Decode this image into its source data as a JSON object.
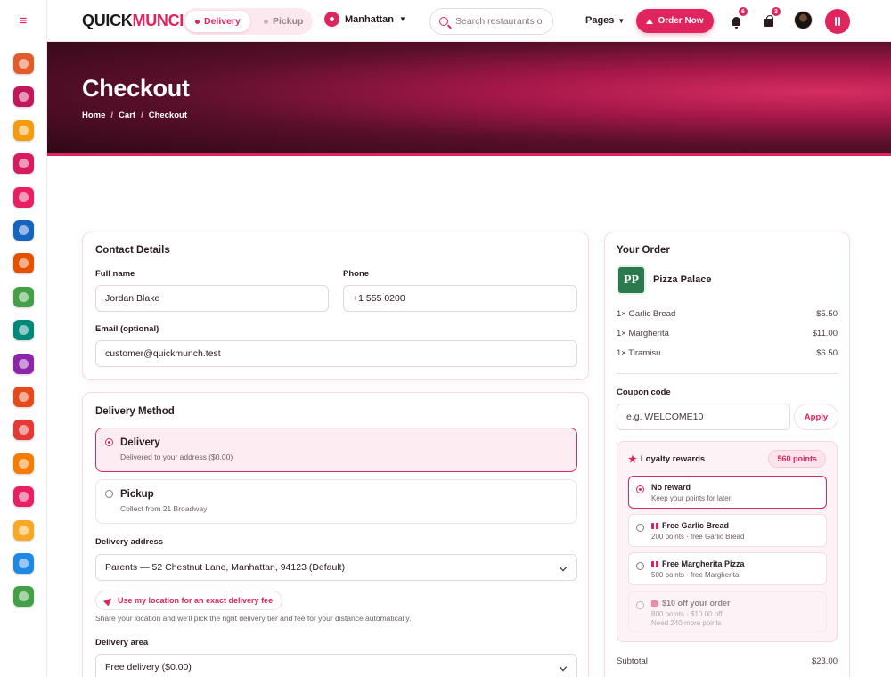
{
  "brand": {
    "logo_main": "QUICK",
    "logo_accent": "MUNCH."
  },
  "header": {
    "mode_delivery": "Delivery",
    "mode_pickup": "Pickup",
    "location": "Manhattan",
    "search_placeholder": "Search restaurants o",
    "pages": "Pages",
    "order_now": "Order Now",
    "notifications_count": "6",
    "cart_count": "3"
  },
  "sidebar": {
    "icons": [
      "burger-icon",
      "cocktail-icon",
      "egg-icon",
      "cupcake-icon",
      "plate-icon",
      "wine-icon",
      "cutlery-icon",
      "pizza-icon",
      "sandwich-icon",
      "hamburger-icon",
      "meat-icon",
      "shrimp-icon",
      "bread-icon",
      "drink-icon",
      "taco-icon",
      "cup-icon",
      "salad-icon"
    ],
    "colors": [
      "#e35b2a",
      "#c2185b",
      "#f39c12",
      "#d81b60",
      "#e91e63",
      "#1565c0",
      "#e65100",
      "#43a047",
      "#00897b",
      "#8e24aa",
      "#e64a19",
      "#e53935",
      "#f57c00",
      "#e91e63",
      "#f9a825",
      "#1e88e5",
      "#43a047"
    ]
  },
  "hero": {
    "title": "Checkout",
    "crumbs": [
      "Home",
      "Cart",
      "Checkout"
    ]
  },
  "contact": {
    "title": "Contact Details",
    "full_name_label": "Full name",
    "full_name_value": "Jordan Blake",
    "phone_label": "Phone",
    "phone_value": "+1 555 0200",
    "email_label": "Email (optional)",
    "email_value": "customer@quickmunch.test"
  },
  "delivery": {
    "title": "Delivery Method",
    "options": [
      {
        "title": "Delivery",
        "sub": "Delivered to your address ($0.00)"
      },
      {
        "title": "Pickup",
        "sub": "Collect from 21 Broadway"
      }
    ],
    "address_label": "Delivery address",
    "address_value": "Parents — 52 Chestnut Lane, Manhattan, 94123 (Default)",
    "use_location": "Use my location for an exact delivery fee",
    "location_help": "Share your location and we'll pick the right delivery tier and fee for your distance automatically.",
    "area_label": "Delivery area",
    "area_value": "Free delivery ($0.00)"
  },
  "order": {
    "title": "Your Order",
    "restaurant_logo": "PP",
    "restaurant": "Pizza Palace",
    "items": [
      {
        "name": "1× Garlic Bread",
        "price": "$5.50"
      },
      {
        "name": "1× Margherita",
        "price": "$11.00"
      },
      {
        "name": "1× Tiramisu",
        "price": "$6.50"
      }
    ],
    "coupon_label": "Coupon code",
    "coupon_placeholder": "e.g. WELCOME10",
    "apply": "Apply",
    "loyalty_title": "Loyalty rewards",
    "points": "560 points",
    "rewards": [
      {
        "title": "No reward",
        "sub": "Keep your points for later.",
        "sub2": ""
      },
      {
        "title": "Free Garlic Bread",
        "sub": "200 points · free Garlic Bread",
        "sub2": ""
      },
      {
        "title": "Free Margherita Pizza",
        "sub": "500 points · free Margherita",
        "sub2": ""
      },
      {
        "title": "$10 off your order",
        "sub": "800 points · $10.00 off",
        "sub2": "Need 240 more points"
      }
    ],
    "subtotal_label": "Subtotal",
    "subtotal_value": "$23.00"
  }
}
